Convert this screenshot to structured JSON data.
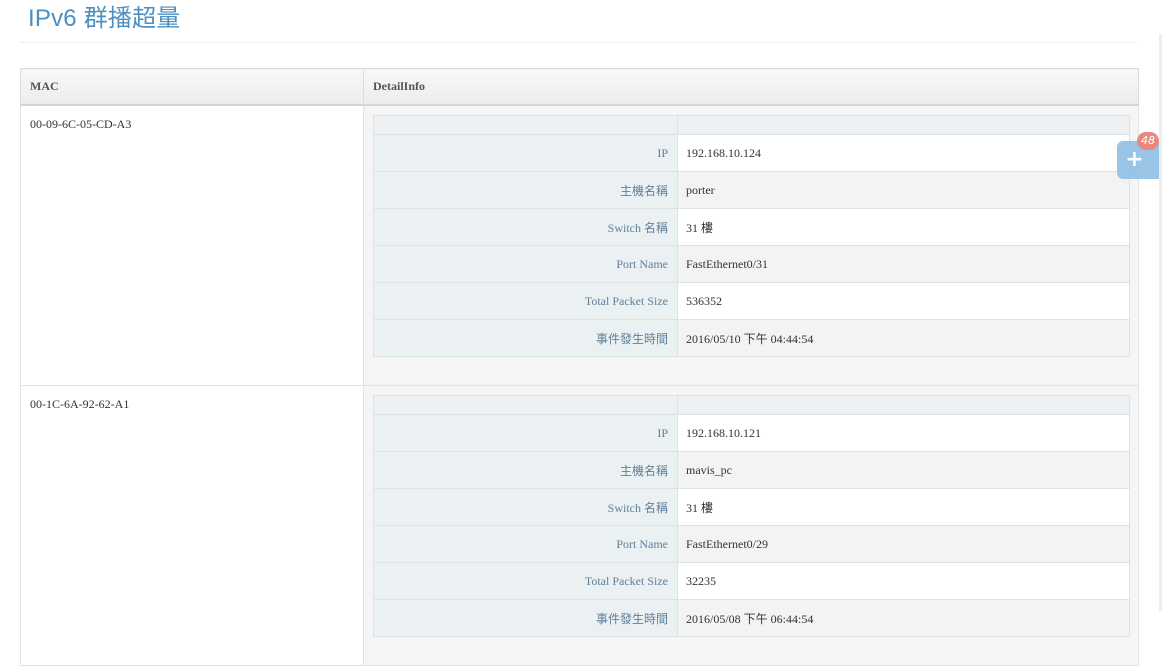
{
  "page": {
    "title": "IPv6 群播超量"
  },
  "table": {
    "headers": {
      "mac": "MAC",
      "detail": "DetailInfo"
    },
    "rows": [
      {
        "mac": "00-09-6C-05-CD-A3",
        "details": [
          {
            "label": "IP",
            "value": "192.168.10.124"
          },
          {
            "label": "主機名稱",
            "value": "porter"
          },
          {
            "label": "Switch 名稱",
            "value": "31 樓"
          },
          {
            "label": "Port Name",
            "value": "FastEthernet0/31"
          },
          {
            "label": "Total Packet Size",
            "value": "536352"
          },
          {
            "label": "事件發生時間",
            "value": "2016/05/10 下午 04:44:54"
          }
        ]
      },
      {
        "mac": "00-1C-6A-92-62-A1",
        "details": [
          {
            "label": "IP",
            "value": "192.168.10.121"
          },
          {
            "label": "主機名稱",
            "value": "mavis_pc"
          },
          {
            "label": "Switch 名稱",
            "value": "31 樓"
          },
          {
            "label": "Port Name",
            "value": "FastEthernet0/29"
          },
          {
            "label": "Total Packet Size",
            "value": "32235"
          },
          {
            "label": "事件發生時間",
            "value": "2016/05/08 下午 06:44:54"
          }
        ]
      }
    ]
  },
  "fab": {
    "icon": "plus-icon",
    "symbol": "+",
    "badge": "48"
  }
}
